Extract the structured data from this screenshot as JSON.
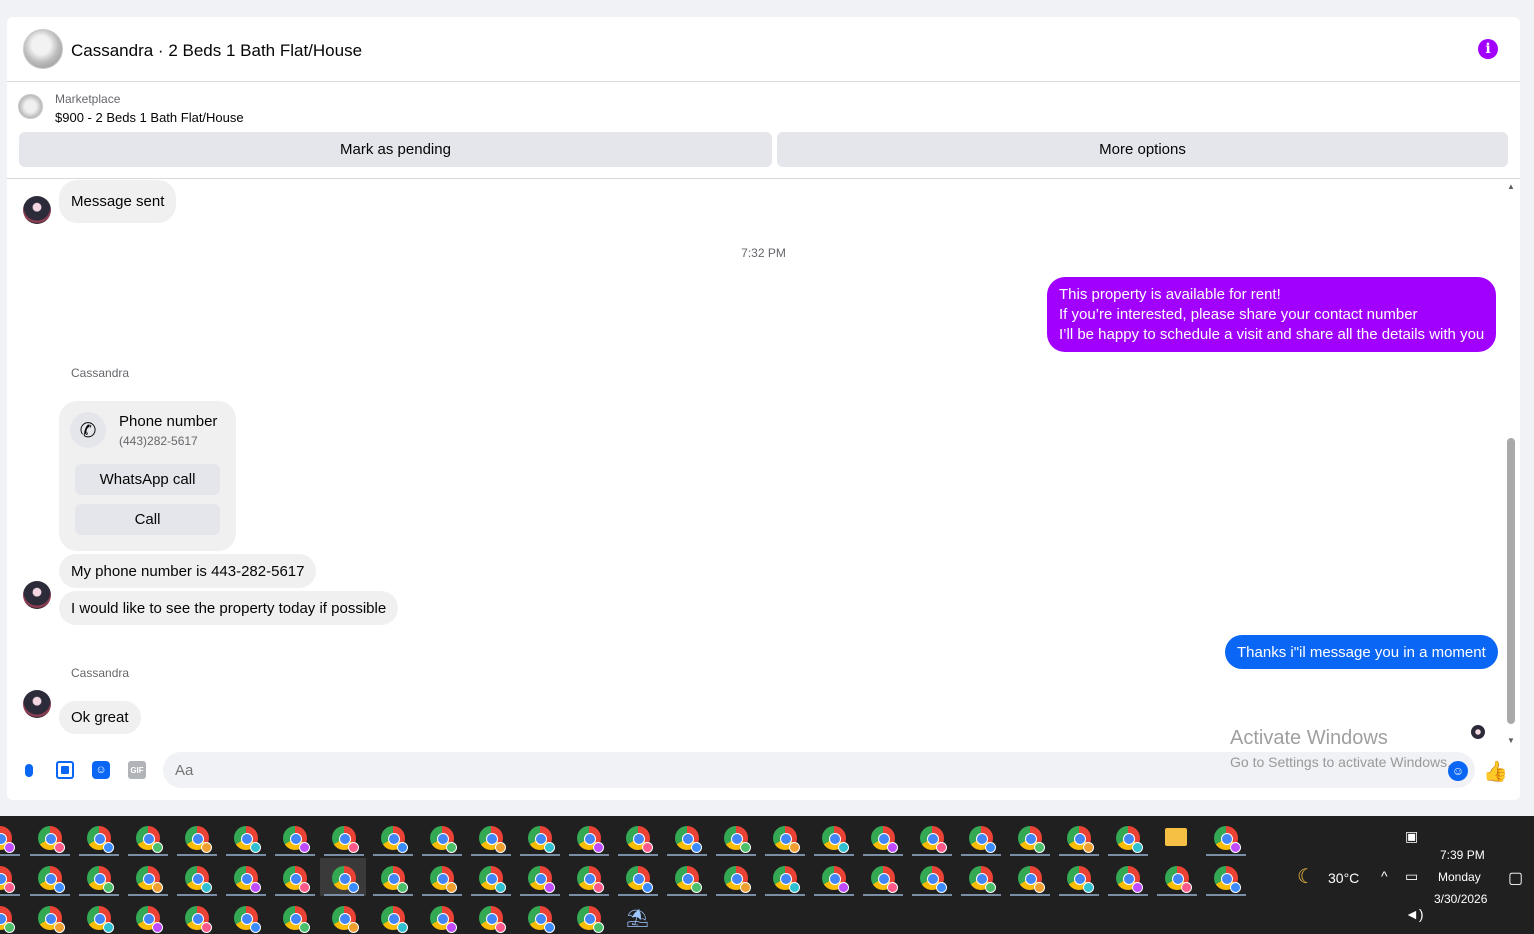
{
  "header": {
    "title": "Cassandra · 2 Beds 1 Bath Flat/House",
    "info_icon": "info-icon",
    "accent": "#a100ff"
  },
  "marketplace": {
    "label": "Marketplace",
    "listing": "$900 - 2 Beds 1 Bath Flat/House",
    "buttons": {
      "pending": "Mark as pending",
      "more": "More options"
    }
  },
  "thread": {
    "top_message": "Message sent",
    "timestamp": "7:32 PM",
    "outgoing_1": {
      "line1": "This property is available for rent!",
      "line2": "If you’re interested, please share your contact number",
      "line3": "I’ll be happy to schedule a visit and share all the details with you"
    },
    "sender_1": "Cassandra",
    "phone_card": {
      "title": "Phone number",
      "number": "(443)282-5617",
      "whatsapp": "WhatsApp call",
      "call": "Call"
    },
    "incoming_phone": "My phone number is 443-282-5617",
    "incoming_visit": "I would like to see the property today if possible",
    "outgoing_2": "Thanks i\"il message you in a moment",
    "sender_2": "Cassandra",
    "incoming_ok": "Ok great"
  },
  "composer": {
    "placeholder": "Aa",
    "icons": [
      "microphone-icon",
      "image-icon",
      "sticker-icon",
      "gif-icon",
      "emoji-icon",
      "like-icon"
    ],
    "gif_label": "GIF"
  },
  "watermark": {
    "line1": "Activate Windows",
    "line2": "Go to Settings to activate Windows."
  },
  "taskbar": {
    "weather": "30°C",
    "time": "7:39 PM",
    "day": "Monday",
    "date": "3/30/2026"
  },
  "colors": {
    "outgoing_purple": "#a100ff",
    "outgoing_blue": "#0a66f5",
    "incoming": "#f0f0f0"
  }
}
